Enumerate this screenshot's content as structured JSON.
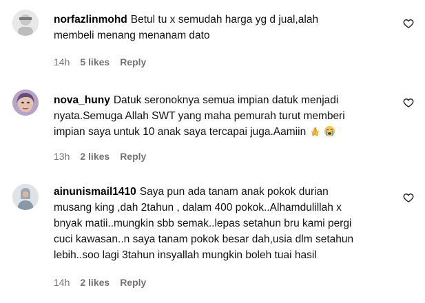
{
  "comments": [
    {
      "username": "norfazlinmohd",
      "lines": [
        "Betul tu x semudah harga yg d jual,alah",
        "membeli menang menanam dato"
      ],
      "emoji_icons": [],
      "time": "14h",
      "likes": "5 likes",
      "reply": "Reply",
      "avatar_icon": "avatar-person-icon",
      "like_icon": "heart-outline-icon"
    },
    {
      "username": "nova_huny",
      "lines": [
        "Datuk seronoknya semua impian datuk menjadi",
        "nyata.Semuga Allah SWT yang maha pemurah turut memberi",
        "impian saya untuk 10 anak saya tercapai juga.Aamiin"
      ],
      "emoji_icons": [
        "folded-hands-emoji",
        "crying-face-emoji"
      ],
      "time": "13h",
      "likes": "2 likes",
      "reply": "Reply",
      "avatar_icon": "avatar-person-icon",
      "like_icon": "heart-outline-icon"
    },
    {
      "username": "ainunismail1410",
      "lines": [
        "Saya pun ada tanam anak pokok durian",
        "musang king ,dah 2tahun , dalam 400 pokok..Alhamdulillah x",
        "bnyak matii..mungkin sbb semak..lepas setahun bru kami pergi",
        "cuci kawasan..n saya tanam pokok besar dah,usia dlm setahun",
        "lebih..soo lagi 3tahun insyallah mungkin boleh tuai hasil"
      ],
      "emoji_icons": [],
      "time": "14h",
      "likes": "2 likes",
      "reply": "Reply",
      "avatar_icon": "avatar-person-icon",
      "like_icon": "heart-outline-icon"
    }
  ],
  "colors": {
    "text": "#111111",
    "meta": "#737373",
    "background": "#ffffff"
  }
}
